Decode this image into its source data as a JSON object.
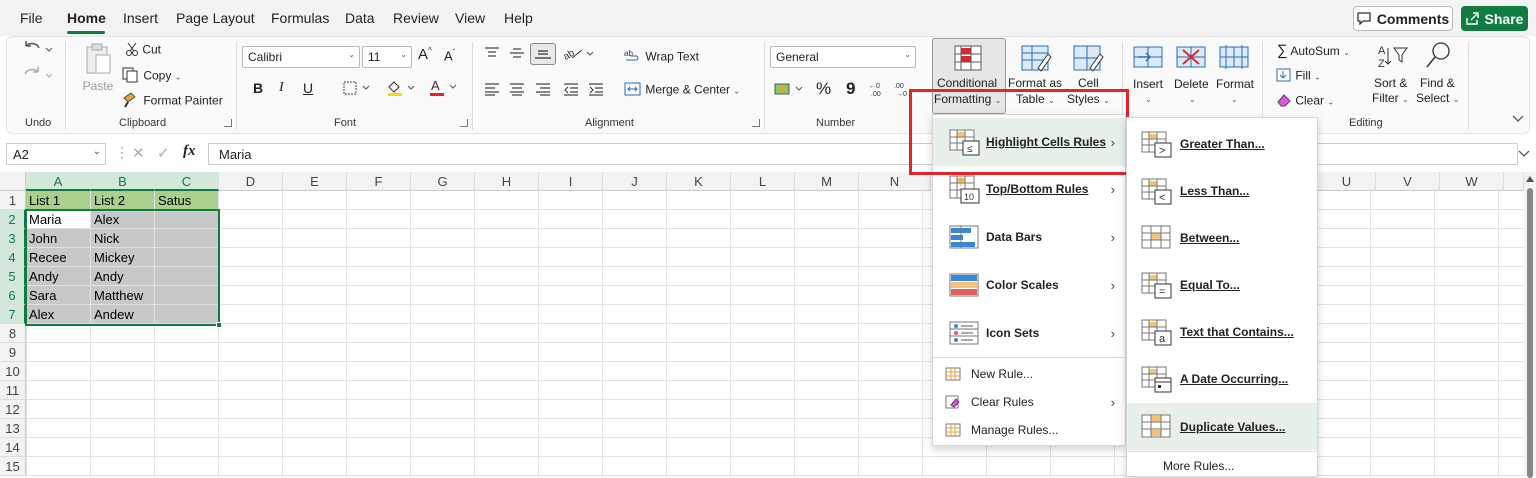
{
  "menubar": {
    "tabs": [
      "File",
      "Home",
      "Insert",
      "Page Layout",
      "Formulas",
      "Data",
      "Review",
      "View",
      "Help"
    ],
    "comments_label": "Comments",
    "share_label": "Share"
  },
  "ribbon": {
    "undo_group": "Undo",
    "clipboard": {
      "group": "Clipboard",
      "paste": "Paste",
      "cut": "Cut",
      "copy": "Copy",
      "format_painter": "Format Painter"
    },
    "font": {
      "group": "Font",
      "family": "Calibri",
      "size": "11",
      "bold": "B",
      "italic": "I",
      "underline": "U"
    },
    "alignment": {
      "group": "Alignment",
      "wrap": "Wrap Text",
      "merge": "Merge & Center"
    },
    "number": {
      "group": "Number",
      "format": "General",
      "percent": "%",
      "comma": "9"
    },
    "styles": {
      "conditional_1": "Conditional",
      "conditional_2": "Formatting",
      "format_table_1": "Format as",
      "format_table_2": "Table",
      "cell_styles_1": "Cell",
      "cell_styles_2": "Styles"
    },
    "cells": {
      "insert": "Insert",
      "delete": "Delete",
      "format": "Format"
    },
    "editing": {
      "group": "Editing",
      "autosum": "AutoSum",
      "fill": "Fill",
      "clear": "Clear",
      "sort_1": "Sort &",
      "sort_2": "Filter",
      "find_1": "Find &",
      "find_2": "Select"
    }
  },
  "formula_bar": {
    "name_box": "A2",
    "fx": "fx",
    "content": "Maria"
  },
  "columns": [
    "A",
    "B",
    "C",
    "D",
    "E",
    "F",
    "G",
    "H",
    "I",
    "J",
    "K",
    "L",
    "M",
    "N",
    "U",
    "V",
    "W"
  ],
  "rows": [
    "1",
    "2",
    "3",
    "4",
    "5",
    "6",
    "7",
    "8",
    "9",
    "10",
    "11",
    "12",
    "13",
    "14",
    "15"
  ],
  "table": {
    "headers": [
      "List 1",
      "List 2",
      "Satus"
    ],
    "rows": [
      [
        "Maria",
        "Alex",
        ""
      ],
      [
        "John",
        "Nick",
        ""
      ],
      [
        "Recee",
        "Mickey",
        ""
      ],
      [
        "Andy",
        "Andy",
        ""
      ],
      [
        "Sara",
        "Matthew",
        ""
      ],
      [
        "Alex",
        "Andew",
        ""
      ]
    ]
  },
  "cf_menu": {
    "items": [
      "Highlight Cells Rules",
      "Top/Bottom Rules",
      "Data Bars",
      "Color Scales",
      "Icon Sets"
    ],
    "new_rule": "New Rule...",
    "clear_rules": "Clear Rules",
    "manage_rules": "Manage Rules..."
  },
  "submenu": {
    "items": [
      "Greater Than...",
      "Less Than...",
      "Between...",
      "Equal To...",
      "Text that Contains...",
      "A Date Occurring...",
      "Duplicate Values..."
    ],
    "icon_glyphs": [
      ">",
      "<",
      "",
      "=",
      "a",
      "",
      ""
    ],
    "more_rules": "More Rules..."
  },
  "colors": {
    "accent": "#107c41",
    "highlight_box": "#e0262b",
    "header_fill": "#a9d08e",
    "selection_fill": "#c8c8c8"
  }
}
